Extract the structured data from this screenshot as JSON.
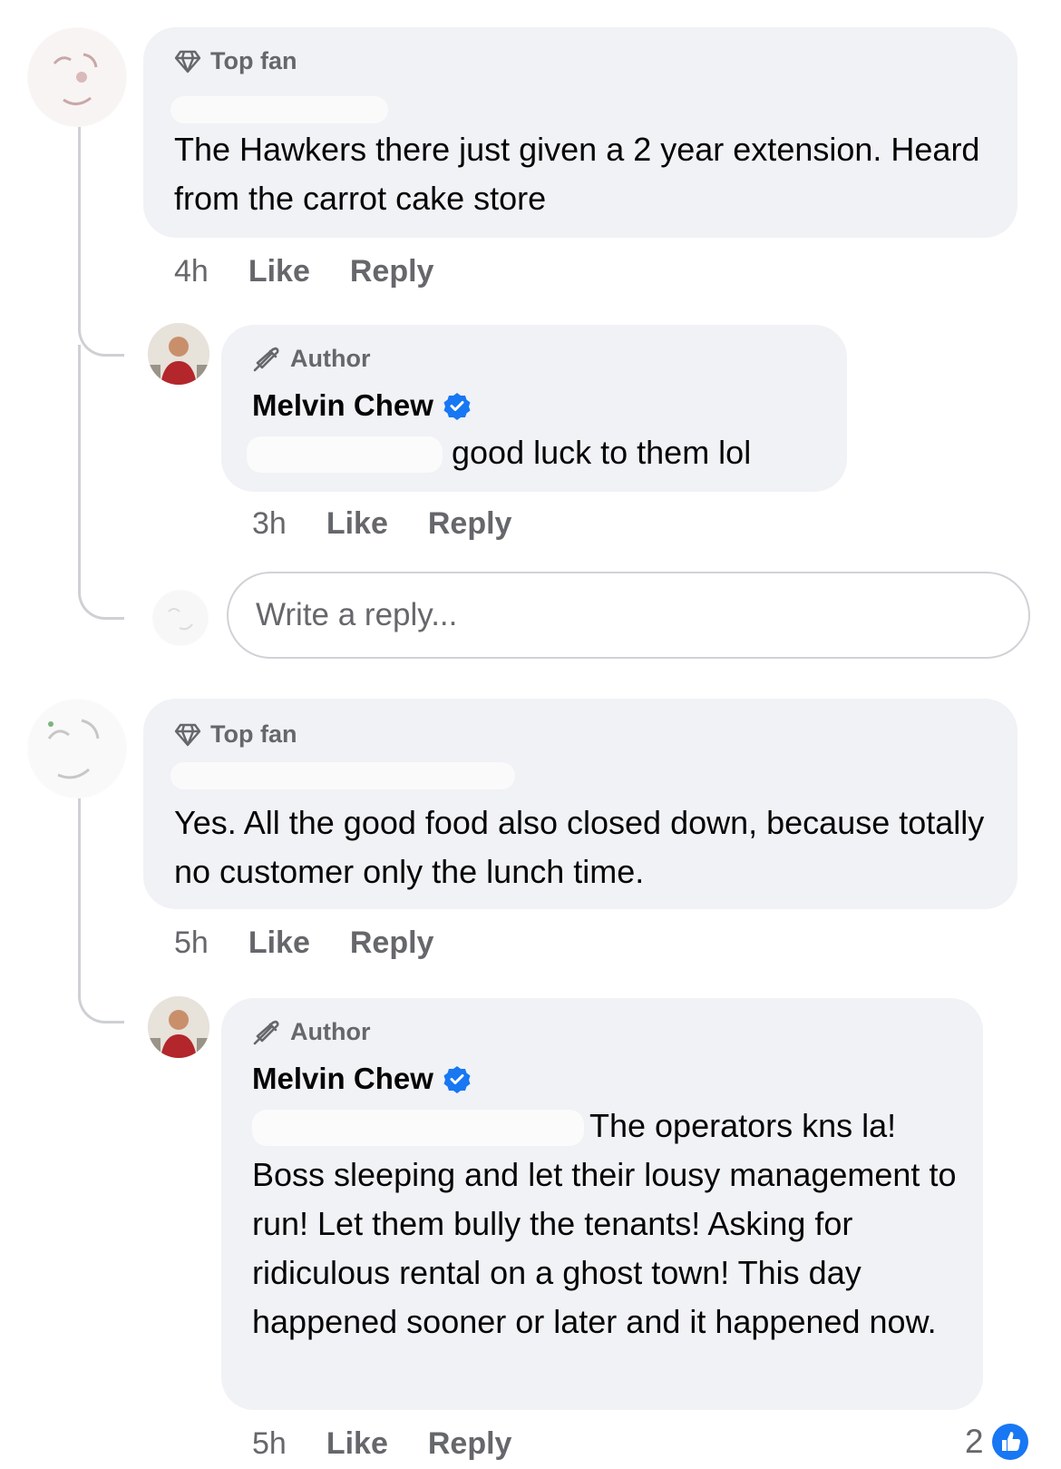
{
  "colors": {
    "verified": "#1877f2",
    "like_reaction": "#1877f2",
    "bubble": "#f0f2f5",
    "muted": "#65676b"
  },
  "comments": [
    {
      "badge": "Top fan",
      "badge_icon": "diamond-icon",
      "text": "The Hawkers there just given a 2 year extension. Heard from the carrot cake store",
      "time": "4h",
      "like": "Like",
      "reply": "Reply"
    },
    {
      "badge": "Author",
      "badge_icon": "megaphone-icon",
      "name": "Melvin Chew",
      "text": "good luck to them lol",
      "time": "3h",
      "like": "Like",
      "reply": "Reply"
    },
    {
      "badge": "Top fan",
      "badge_icon": "diamond-icon",
      "text": "Yes. All the good food also closed down, because totally no customer only the lunch time.",
      "time": "5h",
      "like": "Like",
      "reply": "Reply"
    },
    {
      "badge": "Author",
      "badge_icon": "megaphone-icon",
      "name": "Melvin Chew",
      "text": "The operators kns la! Boss sleeping and let their lousy management to run! Let them bully the tenants! Asking for ridiculous rental on a ghost town! This day happened sooner or later and it happened now.",
      "time": "5h",
      "like": "Like",
      "reply": "Reply",
      "reaction_count": "2"
    }
  ],
  "reply_box": {
    "placeholder": "Write a reply..."
  }
}
